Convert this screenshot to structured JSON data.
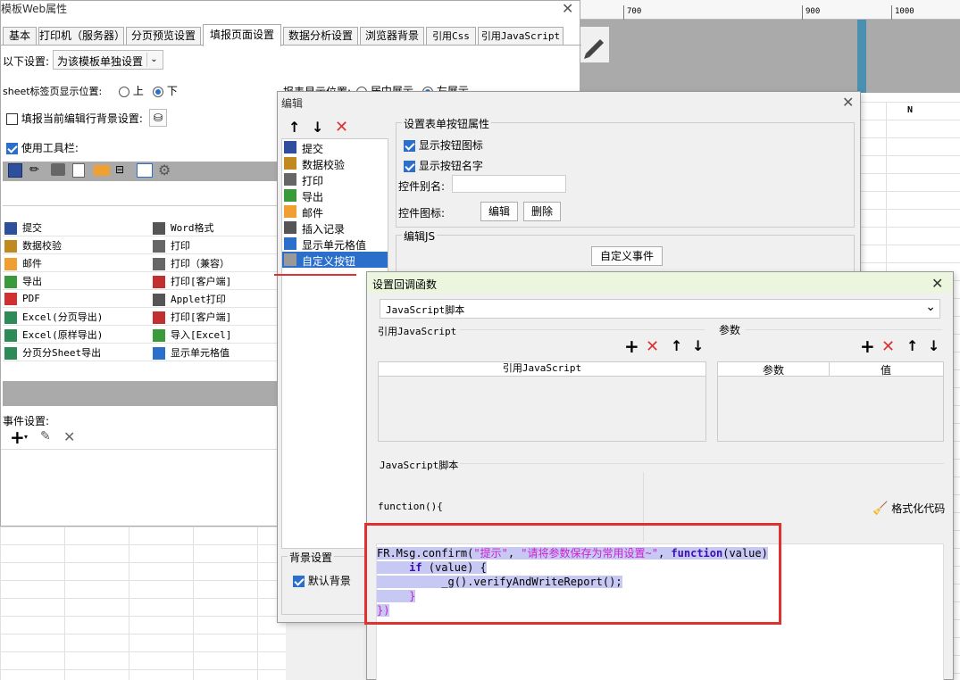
{
  "bg": {
    "ruler_labels": [
      "700",
      "900",
      "1000"
    ],
    "col_letter": "N"
  },
  "main": {
    "title": "模板Web属性",
    "tabs": [
      "基本",
      "打印机（服务器）",
      "分页预览设置",
      "填报页面设置",
      "数据分析设置",
      "浏览器背景",
      "引用Css",
      "引用JavaScript"
    ],
    "active_tab_index": 3,
    "setting_label": "以下设置:",
    "setting_value": "为该模板单独设置",
    "sheet_pos_label": "sheet标签页显示位置:",
    "sheet_pos_up": "上",
    "sheet_pos_down": "下",
    "report_pos_label": "报表显示位置:",
    "report_pos_center": "居中展示",
    "report_pos_left": "左展示",
    "bg_setting_label": "填报当前编辑行背景设置:",
    "use_toolbar_label": "使用工具栏:",
    "buttons_col1": [
      "提交",
      "数据校验",
      "邮件",
      "导出",
      "PDF",
      "Excel(分页导出)",
      "Excel(原样导出)",
      "分页分Sheet导出"
    ],
    "buttons_col2": [
      "Word格式",
      "打印",
      "打印（兼容）",
      "打印[客户端]",
      "Applet打印",
      "打印[客户端]",
      "导入[Excel]",
      "显示单元格值"
    ],
    "event_label": "事件设置:"
  },
  "edit": {
    "title": "编辑",
    "list": [
      "提交",
      "数据校验",
      "打印",
      "导出",
      "邮件",
      "插入记录",
      "显示单元格值",
      "自定义按钮"
    ],
    "selected_index": 7,
    "group_title": "设置表单按钮属性",
    "show_icon": "显示按钮图标",
    "show_name": "显示按钮名字",
    "alias_label": "控件别名:",
    "alias_value": "",
    "icon_label": "控件图标:",
    "edit_btn": "编辑",
    "delete_btn": "删除",
    "js_group": "编辑JS",
    "custom_event_btn": "自定义事件",
    "bg_group": "背景设置",
    "default_bg": "默认背景"
  },
  "callback": {
    "title": "设置回调函数",
    "type_value": "JavaScript脚本",
    "ref_js_label": "引用JavaScript",
    "params_label": "参数",
    "ref_js_header": "引用JavaScript",
    "param_header": "参数",
    "value_header": "值",
    "script_label": "JavaScript脚本",
    "function_head": "function(){",
    "format_btn": "格式化代码",
    "code": {
      "l1_a": "FR.Msg.confirm(",
      "l1_s1": "\"提示\"",
      "l1_c1": ", ",
      "l1_s2": "\"请将参数保存为常用设置~\"",
      "l1_c2": ", ",
      "l1_kw": "function",
      "l1_b": "(value)",
      "l2_kw": "if",
      "l2_b": " (value) {",
      "l3": "_g().verifyAndWriteReport();",
      "l4": "}",
      "l5": "})"
    }
  },
  "colors": {
    "accent": "#2c6fcb",
    "highlight_box": "#e03131",
    "selection": "#c8c8f4",
    "string": "#cc1fd0",
    "keyword": "#3a0fb0"
  }
}
